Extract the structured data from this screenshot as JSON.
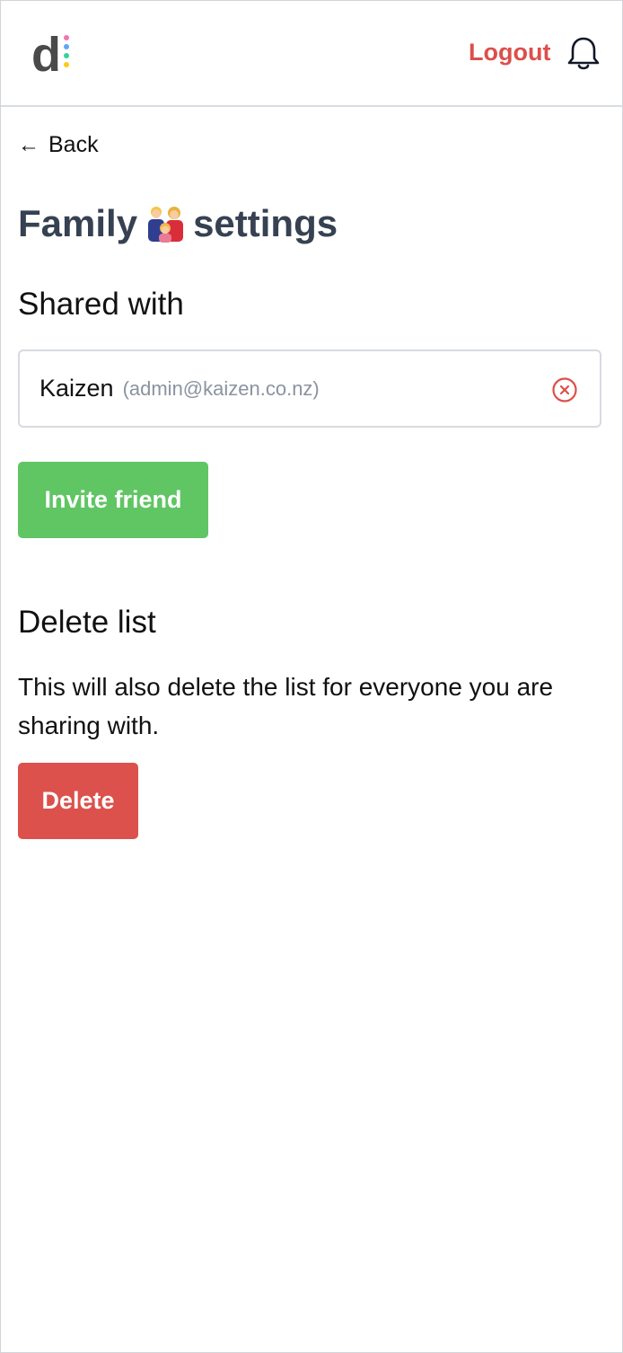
{
  "header": {
    "logo_letter": "d",
    "logout_label": "Logout",
    "notifications_icon": "bell-icon",
    "logo_dot_colors": [
      "#f472b6",
      "#60a5fa",
      "#34d399",
      "#facc15"
    ]
  },
  "nav": {
    "back_arrow": "←",
    "back_label": "Back"
  },
  "page": {
    "title_before": "Family",
    "title_emoji": "family-emoji",
    "title_after": "settings"
  },
  "shared": {
    "heading": "Shared with",
    "members": [
      {
        "name": "Kaizen",
        "email": "(admin@kaizen.co.nz)",
        "remove_icon": "remove-circle-icon"
      }
    ],
    "invite_label": "Invite friend"
  },
  "delete_section": {
    "heading": "Delete list",
    "description": "This will also delete the list for everyone you are sharing with.",
    "delete_label": "Delete"
  },
  "colors": {
    "accent_red": "#dc4f4a",
    "invite_green": "#60c563",
    "title_slate": "#364152"
  }
}
